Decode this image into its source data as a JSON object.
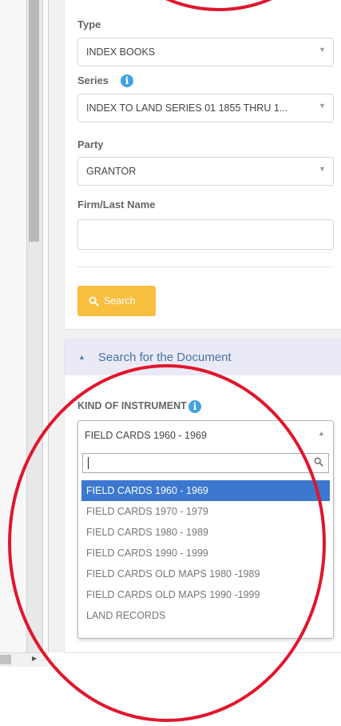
{
  "form": {
    "type_label": "Type",
    "type_value": "INDEX BOOKS",
    "series_label": "Series",
    "series_value": "INDEX TO LAND SERIES 01 1855 THRU 1...",
    "party_label": "Party",
    "party_value": "GRANTOR",
    "name_label": "Firm/Last Name",
    "name_value": "",
    "search_button": "Search"
  },
  "section": {
    "title": "Search for the Document",
    "instrument_label": "KIND OF INSTRUMENT",
    "instrument_value": "FIELD CARDS 1960 - 1969",
    "search_value": "",
    "options": [
      "FIELD CARDS 1960 - 1969",
      "FIELD CARDS 1970 - 1979",
      "FIELD CARDS 1980 - 1989",
      "FIELD CARDS 1990 - 1999",
      "FIELD CARDS OLD MAPS 1980 -1989",
      "FIELD CARDS OLD MAPS 1990 -1999",
      "LAND RECORDS"
    ],
    "highlighted_index": 0
  },
  "colors": {
    "accent_yellow": "#f8be3e",
    "info_blue": "#42a3e0",
    "highlight_blue": "#3c78d0",
    "annotation_red": "#e0162b"
  }
}
